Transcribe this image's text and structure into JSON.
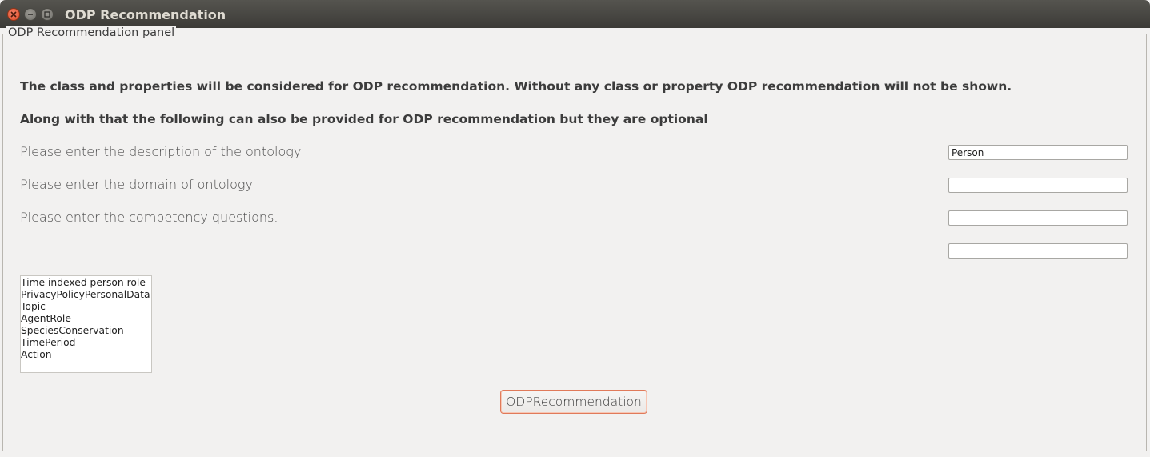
{
  "window": {
    "title": "ODP Recommendation"
  },
  "panel": {
    "legend": "ODP Recommendation panel",
    "intro_line_1": "The class and properties will be considered for ODP recommendation. Without any class or property ODP recommendation will not be shown.",
    "intro_line_2": "Along with that the following can also be provided for ODP recommendation but they are optional"
  },
  "form": {
    "description_label": "Please enter the description of the ontology",
    "description_value": "Person",
    "domain_label": "Please enter the domain of ontology",
    "domain_value": "",
    "competency_label": "Please enter the competency questions.",
    "competency_value_1": "",
    "competency_value_2": ""
  },
  "recommendations": [
    "Time indexed person role",
    "PrivacyPolicyPersonalData",
    "Topic",
    "AgentRole",
    "SpeciesConservation",
    "TimePeriod",
    "Action"
  ],
  "actions": {
    "recommend_label": "ODPRecommendation"
  },
  "colors": {
    "titlebar": "#3c3b37",
    "close_button": "#df4a25",
    "window_background": "#f2f1f0",
    "button_focus_border": "#e07a5a"
  }
}
